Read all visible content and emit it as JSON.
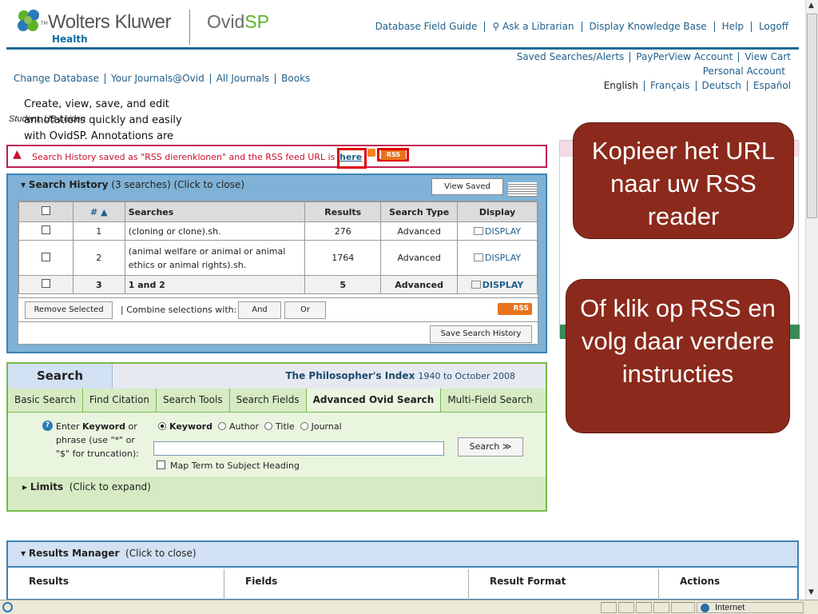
{
  "header": {
    "brand": "Wolters Kluwer",
    "brand_tm": "TM",
    "brand_sub": "Health",
    "product_prefix": "Ovid",
    "product_suffix": "SP",
    "top_links": [
      "Database Field Guide",
      "Ask a Librarian",
      "Display Knowledge Base",
      "Help",
      "Logoff"
    ],
    "account_links": [
      "Saved Searches/Alerts",
      "PayPerView Account",
      "View Cart"
    ],
    "personal_account": "Personal Account",
    "languages": [
      "English",
      "Français",
      "Deutsch",
      "Español"
    ],
    "db_links": [
      "Change Database",
      "Your Journals@Ovid",
      "All Journals",
      "Books"
    ],
    "user": "Student, UB-Leiden"
  },
  "alert": {
    "text": "Search History saved as \"RSS dierenklonen\" and the RSS feed URL is",
    "link": "here",
    "rss_label": "RSS"
  },
  "history": {
    "title": "Search History",
    "count": "(3 searches)",
    "toggle": "(Click to close)",
    "view_saved": "View Saved",
    "columns": [
      "#",
      "Searches",
      "Results",
      "Search Type",
      "Display"
    ],
    "sort_indicator": "▲",
    "rows": [
      {
        "num": "1",
        "query": "(cloning or clone).sh.",
        "results": "276",
        "type": "Advanced",
        "display": "DISPLAY"
      },
      {
        "num": "2",
        "query": "(animal welfare or animal or animal ethics or animal rights).sh.",
        "results": "1764",
        "type": "Advanced",
        "display": "DISPLAY"
      },
      {
        "num": "3",
        "query": "1 and 2",
        "results": "5",
        "type": "Advanced",
        "display": "DISPLAY"
      }
    ],
    "remove_selected": "Remove Selected",
    "combine_label": "| Combine selections with:",
    "and_btn": "And",
    "or_btn": "Or",
    "rss_label": "RSS",
    "save_history": "Save Search History"
  },
  "search": {
    "tab": "Search",
    "database": "The Philosopher's Index",
    "coverage": "1940 to October 2008",
    "subtabs": [
      "Basic Search",
      "Find Citation",
      "Search Tools",
      "Search Fields",
      "Advanced Ovid Search",
      "Multi-Field Search"
    ],
    "active_subtab": "Advanced Ovid Search",
    "enter_prefix": "Enter ",
    "enter_bold": "Keyword",
    "enter_rest": " or phrase (use \"*\" or \"$\" for truncation):",
    "options": [
      "Keyword",
      "Author",
      "Title",
      "Journal"
    ],
    "selected_option": "Keyword",
    "input_value": "",
    "search_button": "Search ≫",
    "map_term": "Map Term to Subject Heading",
    "limits": "Limits",
    "limits_toggle": "(Click to expand)"
  },
  "results_manager": {
    "title": "Results Manager",
    "toggle": "(Click to close)",
    "columns": [
      "Results",
      "Fields",
      "Result Format",
      "Actions"
    ]
  },
  "side": {
    "annotation_text": "Create, view, save, and edit\nannotations quickly and easily\nwith OvidSP. Annotations are"
  },
  "callouts": {
    "copy_url": "Kopieer het URL naar uw RSS reader",
    "click_rss": "Of klik op RSS en volg daar verdere instructies"
  },
  "statusbar": {
    "zone": "Internet"
  },
  "colors": {
    "brand_blue": "#1e6a93",
    "callout_red": "#8b2a1c",
    "alert_red": "#c8102e",
    "search_green": "#78b84a",
    "rss_orange": "#e9731c"
  }
}
